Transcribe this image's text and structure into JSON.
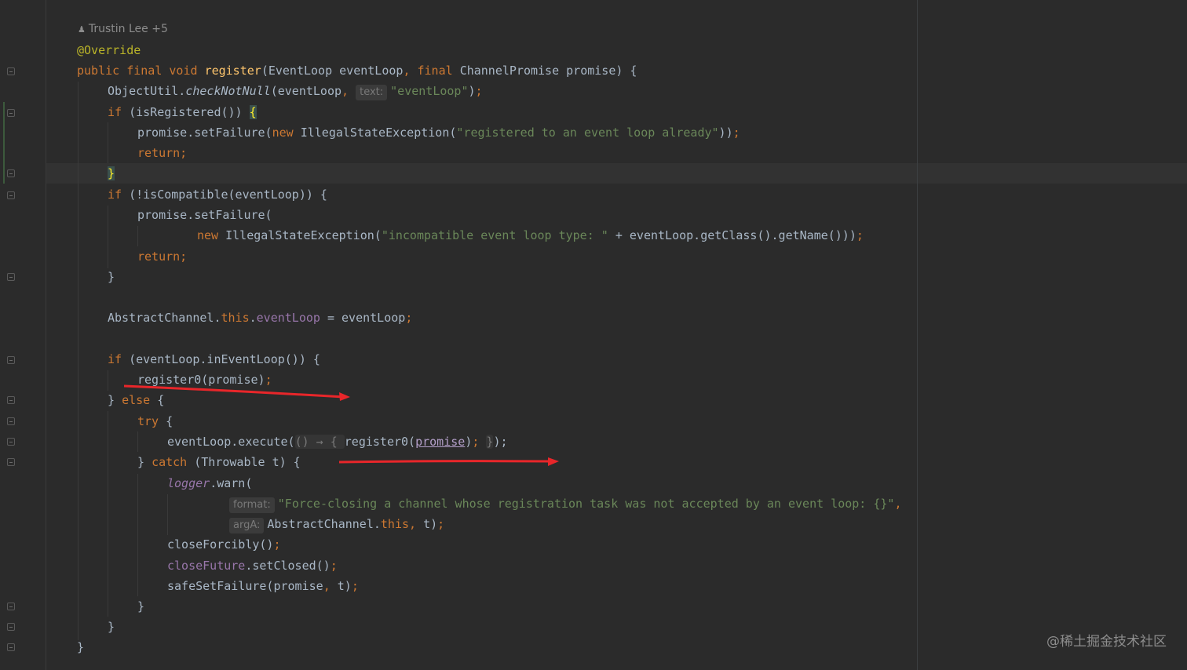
{
  "author_hint": {
    "name": "Trustin Lee +5"
  },
  "code": {
    "annotation": "@Override",
    "sig_public": "public ",
    "sig_final": "final ",
    "sig_void": "void ",
    "sig_name": "register",
    "sig_params_1": "(EventLoop eventLoop",
    "sig_comma": ", ",
    "sig_final2": "final ",
    "sig_params_2": "ChannelPromise promise) {",
    "l3_a": "ObjectUtil.",
    "l3_b": "checkNotNull",
    "l3_c": "(eventLoop",
    "l3_comma": ", ",
    "l3_hint": "text:",
    "l3_str": "\"eventLoop\"",
    "l3_end": ")",
    "l3_semi": ";",
    "l4_if": "if ",
    "l4_cond": "(isRegistered()) ",
    "l4_brace": "{",
    "l5_a": "promise.setFailure(",
    "l5_new": "new ",
    "l5_b": "IllegalStateException(",
    "l5_str": "\"registered to an event loop already\"",
    "l5_end": "))",
    "l5_semi": ";",
    "l6_return": "return;",
    "l7_brace": "}",
    "l8_if": "if ",
    "l8_cond": "(!isCompatible(eventLoop)) {",
    "l9": "promise.setFailure(",
    "l10_new": "new ",
    "l10_a": "IllegalStateException(",
    "l10_str": "\"incompatible event loop type: \"",
    "l10_b": " + eventLoop.getClass().getName()))",
    "l10_semi": ";",
    "l11_return": "return;",
    "l12": "}",
    "l14_a": "AbstractChannel.",
    "l14_this": "this",
    "l14_dot": ".",
    "l14_field": "eventLoop",
    "l14_b": " = eventLoop",
    "l14_semi": ";",
    "l16_if": "if ",
    "l16_cond": "(eventLoop.inEventLoop()) {",
    "l17_a": "register0(promise)",
    "l17_semi": ";",
    "l18_a": "} ",
    "l18_else": "else ",
    "l18_b": "{",
    "l19_try": "try ",
    "l19_b": "{",
    "l20_a": "eventLoop.execute(",
    "l20_fold": "() → { ",
    "l20_b": "register0(",
    "l20_promise": "promise",
    "l20_c": ")",
    "l20_semi": "; ",
    "l20_fold2": "}",
    "l20_d": ");",
    "l21_a": "} ",
    "l21_catch": "catch ",
    "l21_b": "(Throwable t) {",
    "l22_logger": "logger",
    "l22_b": ".warn(",
    "l23_hint": "format:",
    "l23_str": "\"Force-closing a channel whose registration task was not accepted by an event loop: {}\"",
    "l23_comma": ",",
    "l24_hint": "argA:",
    "l24_a": "AbstractChannel.",
    "l24_this": "this",
    "l24_comma": ", ",
    "l24_b": "t)",
    "l24_semi": ";",
    "l25_a": "closeForcibly()",
    "l25_semi": ";",
    "l26_field": "closeFuture",
    "l26_b": ".setClosed()",
    "l26_semi": ";",
    "l27_a": "safeSetFailure(promise",
    "l27_comma": ", ",
    "l27_b": "t)",
    "l27_semi": ";",
    "l28": "}",
    "l29": "}",
    "l30": "}"
  },
  "watermark": "@稀土掘金技术社区",
  "colors": {
    "background": "#2b2b2b",
    "keyword": "#cc7832",
    "string": "#6a8759",
    "method": "#ffc66d",
    "field": "#9876aa",
    "annotation_arrow": "#e8262a"
  }
}
